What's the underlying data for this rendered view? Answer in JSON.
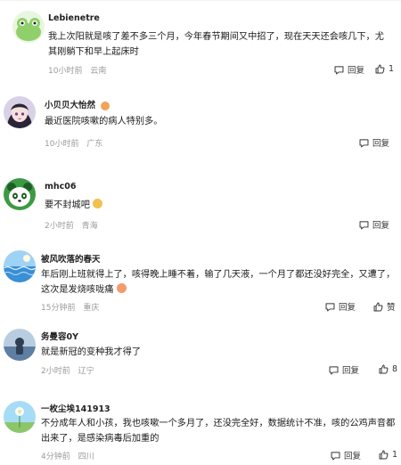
{
  "comments": [
    {
      "username": "Lebienetre",
      "content": "我上次阳就是咳了差不多三个月，今年春节期间又中招了，现在天天还会咳几下，尤其刚躺下和早上起床时",
      "time": "10小时前",
      "location": "云南",
      "reply_label": "回复",
      "like_count": "1",
      "avatar_color": "#9ad37a"
    },
    {
      "username": "小贝贝大怡然",
      "content": "最近医院咳嗽的病人特别多。",
      "time": "10小时前",
      "location": "广东",
      "reply_label": "回复",
      "like_count": "",
      "avatar_color": "#3a3350"
    },
    {
      "username": "mhc06",
      "content": "要不封城吧",
      "time": "2小时前",
      "location": "青海",
      "reply_label": "回复",
      "like_count": "",
      "avatar_color": "#2e8b3a"
    },
    {
      "username": "被风吹落的春天",
      "content": "年后刚上班就得上了，咳得晚上睡不着，输了几天液，一个月了都还没好完全，又遭了，这次是发烧咳咙痛",
      "time": "15分钟前",
      "location": "重庆",
      "reply_label": "回复",
      "like_label": "赞",
      "avatar_color": "#5aa7e0"
    },
    {
      "username": "务曼容0Y",
      "content": "就是新冠的变种我才得了",
      "time": "2小时前",
      "location": "辽宁",
      "reply_label": "回复",
      "like_count": "8",
      "avatar_color": "#6b8fb5"
    },
    {
      "username": "一枚尘埃141913",
      "content": "不分成年人和小孩，我也咳嗽一个多月了，还没完全好，数据统计不准，咳的公鸡声音都出来了，是感染病毒后加重的",
      "time": "4分钟前",
      "location": "四川",
      "reply_label": "回复",
      "like_count": "1",
      "avatar_color": "#8ccff0"
    }
  ],
  "icons": {
    "reply": "comment-bubble-icon",
    "like": "thumbs-up-icon",
    "more": "more-dots-icon"
  }
}
